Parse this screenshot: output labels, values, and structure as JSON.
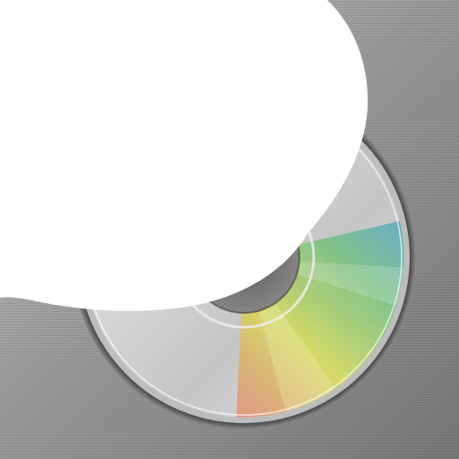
{
  "icon": {
    "name": "disc-burner-app-icon",
    "symbol": "compact-disc-icon"
  },
  "colors": {
    "metal_light": "#b9b9b9",
    "metal_dark": "#6f6f6f",
    "disc_silver": "#d9d9d9",
    "disc_rim": "#a7a7a7",
    "rainbow_red": "#e27b87",
    "rainbow_yellow": "#d7db56",
    "rainbow_green": "#6fc07a",
    "rainbow_blue": "#4ea2de",
    "cover_white": "#ffffff"
  }
}
